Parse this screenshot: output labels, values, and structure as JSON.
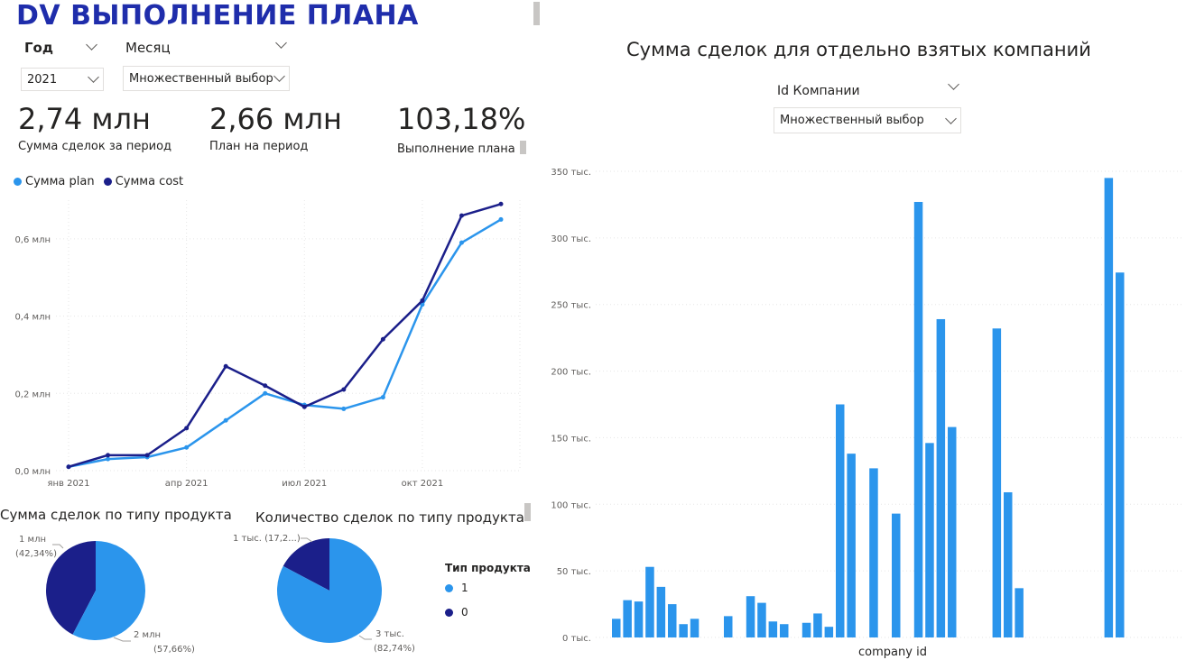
{
  "title": "DV ВЫПОЛНЕНИЕ ПЛАНА",
  "slicers": {
    "year": {
      "label": "Год",
      "value": "2021"
    },
    "month": {
      "label": "Месяц",
      "value": "Множественный выбор"
    },
    "company": {
      "label": "Id Компании",
      "value": "Множественный выбор"
    }
  },
  "kpis": [
    {
      "value": "2,74 млн",
      "label": "Сумма сделок за период"
    },
    {
      "value": "2,66 млн",
      "label": "План на период"
    },
    {
      "value": "103,18%",
      "label": "Выполнение плана"
    }
  ],
  "colors": {
    "light": "#2b95ec",
    "dark": "#1b1f8a",
    "title": "#1f2dab"
  },
  "line_chart": {
    "type": "line",
    "series": [
      {
        "name": "Сумма plan",
        "color": "#2b95ec",
        "values": [
          0.01,
          0.03,
          0.035,
          0.06,
          0.13,
          0.2,
          0.17,
          0.16,
          0.19,
          0.43,
          0.59,
          0.65
        ]
      },
      {
        "name": "Сумма cost",
        "color": "#1b1f8a",
        "values": [
          0.01,
          0.04,
          0.04,
          0.11,
          0.27,
          0.22,
          0.165,
          0.21,
          0.34,
          0.44,
          0.66,
          0.69
        ]
      }
    ],
    "y_ticks": [
      "0,0 млн",
      "0,2 млн",
      "0,4 млн",
      "0,6 млн"
    ],
    "x_ticks": [
      "янв 2021",
      "апр 2021",
      "июл 2021",
      "окт 2021"
    ],
    "ylim": [
      0,
      0.7
    ]
  },
  "pie_sum": {
    "title": "Сумма сделок по типу продукта",
    "slices": [
      {
        "label_line1": "1 млн",
        "label_line2": "(42,34%)",
        "value": 42.34,
        "color": "#1b1f8a"
      },
      {
        "label_line1": "2 млн",
        "label_line2": "(57,66%)",
        "value": 57.66,
        "color": "#2b95ec"
      }
    ]
  },
  "pie_count": {
    "title": "Количество сделок по типу продукта",
    "slices": [
      {
        "label_line1": "1 тыс. (17,2...)",
        "label_line2": "",
        "value": 17.26,
        "color": "#1b1f8a"
      },
      {
        "label_line1": "3 тыс.",
        "label_line2": "(82,74%)",
        "value": 82.74,
        "color": "#2b95ec"
      }
    ]
  },
  "pie_legend": {
    "title": "Тип продукта",
    "items": [
      {
        "label": "1",
        "color": "#2b95ec"
      },
      {
        "label": "0",
        "color": "#1b1f8a"
      }
    ]
  },
  "bar_chart": {
    "type": "bar",
    "title": "Сумма сделок для отдельно взятых компаний",
    "xlabel": "company id",
    "ylim": [
      0,
      350
    ],
    "y_ticks": [
      "0 тыс.",
      "50 тыс.",
      "100 тыс.",
      "150 тыс.",
      "200 тыс.",
      "250 тыс.",
      "300 тыс.",
      "350 тыс."
    ],
    "values": [
      14,
      28,
      27,
      53,
      38,
      25,
      10,
      14,
      null,
      null,
      16,
      null,
      31,
      26,
      12,
      10,
      null,
      11,
      18,
      8,
      175,
      138,
      null,
      127,
      null,
      93,
      null,
      327,
      146,
      239,
      158,
      null,
      null,
      null,
      232,
      109,
      37,
      null,
      null,
      null,
      null,
      null,
      null,
      null,
      345,
      274
    ],
    "color": "#2b95ec"
  }
}
